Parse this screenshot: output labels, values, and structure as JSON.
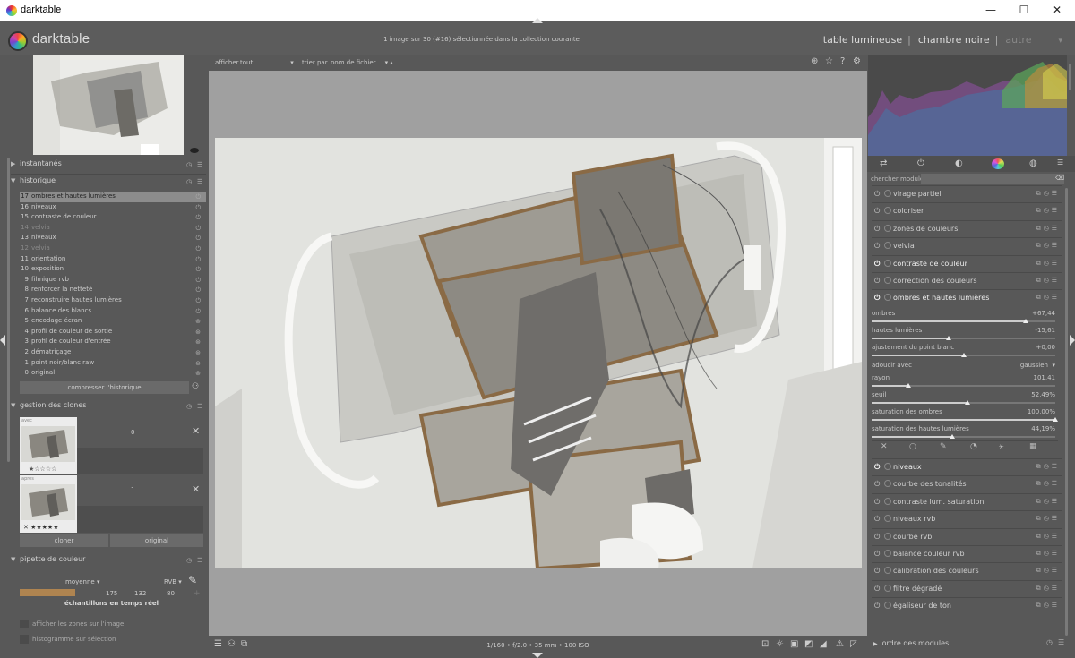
{
  "window": {
    "title": "darktable",
    "minimize": "—",
    "maximize": "☐",
    "close": "✕"
  },
  "header": {
    "app_name": "darktable",
    "collection_info": "1 image sur 30 (#16) sélectionnée dans la collection courante",
    "views": {
      "lighttable": "table lumineuse",
      "darkroom": "chambre noire",
      "other": "autre",
      "sep": "|"
    }
  },
  "left": {
    "snapshots": {
      "title": "instantanés"
    },
    "history": {
      "title": "historique",
      "items": [
        {
          "n": "17",
          "label": "ombres et hautes lumières",
          "state": "on"
        },
        {
          "n": "16",
          "label": "niveaux",
          "state": "on"
        },
        {
          "n": "15",
          "label": "contraste de couleur",
          "state": "on"
        },
        {
          "n": "14",
          "label": "velvia",
          "state": "off"
        },
        {
          "n": "13",
          "label": "niveaux",
          "state": "on"
        },
        {
          "n": "12",
          "label": "velvia",
          "state": "off"
        },
        {
          "n": "11",
          "label": "orientation",
          "state": "on"
        },
        {
          "n": "10",
          "label": "exposition",
          "state": "on"
        },
        {
          "n": "9",
          "label": "filmique rvb",
          "state": "on"
        },
        {
          "n": "8",
          "label": "renforcer la netteté",
          "state": "on"
        },
        {
          "n": "7",
          "label": "reconstruire hautes lumières",
          "state": "on"
        },
        {
          "n": "6",
          "label": "balance des blancs",
          "state": "on"
        },
        {
          "n": "5",
          "label": "encodage écran",
          "state": "always"
        },
        {
          "n": "4",
          "label": "profil de couleur de sortie",
          "state": "always"
        },
        {
          "n": "3",
          "label": "profil de couleur d'entrée",
          "state": "always"
        },
        {
          "n": "2",
          "label": "dématriçage",
          "state": "always"
        },
        {
          "n": "1",
          "label": "point noir/blanc raw",
          "state": "always"
        },
        {
          "n": "0",
          "label": "original",
          "state": "always"
        }
      ],
      "compress_button": "compresser l'historique"
    },
    "clones": {
      "title": "gestion des clones",
      "items": [
        {
          "tag": "avec",
          "version": "0"
        },
        {
          "tag": "après",
          "version": "1"
        }
      ],
      "clone_button": "cloner",
      "original_button": "original"
    },
    "picker": {
      "title": "pipette de couleur",
      "mode": "moyenne",
      "colorspace": "RVB",
      "values": [
        "175",
        "132",
        "80"
      ],
      "swatch_color": "#af8450",
      "live_samples": "échantillons en temps réel",
      "show_zones": "afficher les zones sur l'image",
      "histogram_selection": "histogramme sur sélection"
    }
  },
  "center": {
    "filter_label": "afficher",
    "filter_value": "tout",
    "sort_label": "trier par",
    "sort_value": "nom de fichier",
    "exif": "1/160 • f/2.0 • 35 mm • 100 ISO"
  },
  "right": {
    "search_label": "chercher module",
    "modules_top": [
      {
        "label": "virage partiel",
        "on": false
      },
      {
        "label": "coloriser",
        "on": false
      },
      {
        "label": "zones de couleurs",
        "on": false
      },
      {
        "label": "velvia",
        "on": false
      },
      {
        "label": "contraste de couleur",
        "on": true
      },
      {
        "label": "correction des couleurs",
        "on": false
      },
      {
        "label": "ombres et hautes lumières",
        "on": true
      }
    ],
    "params": [
      {
        "label": "ombres",
        "value": "+67,44",
        "level": 0.84
      },
      {
        "label": "hautes lumières",
        "value": "-15,61",
        "level": 0.42
      },
      {
        "label": "ajustement du point blanc",
        "value": "+0,00",
        "level": 0.5
      },
      {
        "label": "adoucir avec",
        "value": "gaussien"
      },
      {
        "label": "rayon",
        "value": "101,41",
        "level": 0.2
      },
      {
        "label": "seuil",
        "value": "52,49%",
        "level": 0.52
      },
      {
        "label": "saturation des ombres",
        "value": "100,00%",
        "level": 1.0
      },
      {
        "label": "saturation des hautes lumières",
        "value": "44,19%",
        "level": 0.44
      }
    ],
    "modules_bottom": [
      {
        "label": "niveaux",
        "on": true
      },
      {
        "label": "courbe des tonalités",
        "on": false
      },
      {
        "label": "contraste lum. saturation",
        "on": false
      },
      {
        "label": "niveaux rvb",
        "on": false
      },
      {
        "label": "courbe rvb",
        "on": false
      },
      {
        "label": "balance couleur rvb",
        "on": false
      },
      {
        "label": "calibration des couleurs",
        "on": false
      },
      {
        "label": "filtre dégradé",
        "on": false
      },
      {
        "label": "égaliseur de ton",
        "on": false
      }
    ],
    "module_order": "ordre des modules"
  }
}
